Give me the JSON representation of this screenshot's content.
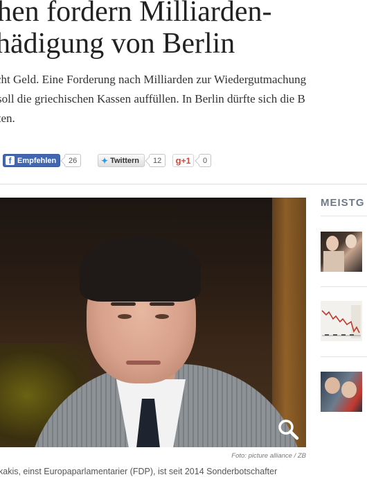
{
  "article": {
    "headline_line1": "hen fordern Milliarden-",
    "headline_line2": "hädigung von Berlin",
    "teaser_line1": "cht Geld. Eine Forderung nach Milliarden zur Wiedergutmachung",
    "teaser_line2": "soll die griechischen Kassen auffüllen. In Berlin dürfte sich die B",
    "teaser_line3": "lten."
  },
  "share": {
    "facebook_label": "Empfehlen",
    "facebook_icon": "f",
    "facebook_count": "26",
    "twitter_label": "Twittern",
    "twitter_count": "12",
    "gplus_label": "+1",
    "gplus_icon": "g",
    "gplus_count": "0"
  },
  "photo": {
    "credit": "Foto: picture alliance / ZB",
    "caption": "kakis, einst Europaparlamentarier (FDP), ist seit 2014 Sonderbotschafter"
  },
  "sidebar": {
    "title": "MEISTG"
  },
  "colors": {
    "facebook": "#4267b2",
    "twitter_bird": "#2b9ae8",
    "gplus": "#d14836",
    "rail_title": "#6e7a86"
  }
}
